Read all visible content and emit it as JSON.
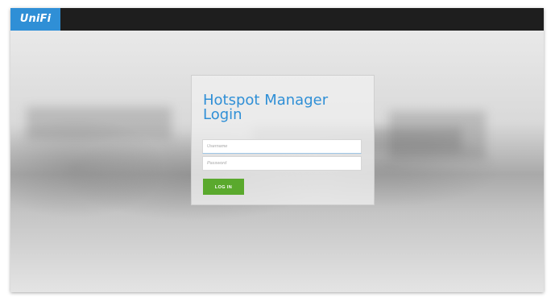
{
  "header": {
    "logo_text": "UniFi",
    "logo_color": "#2f8fd6",
    "bar_color": "#1e1e1e"
  },
  "login": {
    "title": "Hotspot Manager Login",
    "username_placeholder": "Username",
    "username_value": "",
    "password_placeholder": "Password",
    "password_value": "",
    "button_label": "LOG IN",
    "button_color": "#5aa92d",
    "title_color": "#2f8fd6"
  }
}
